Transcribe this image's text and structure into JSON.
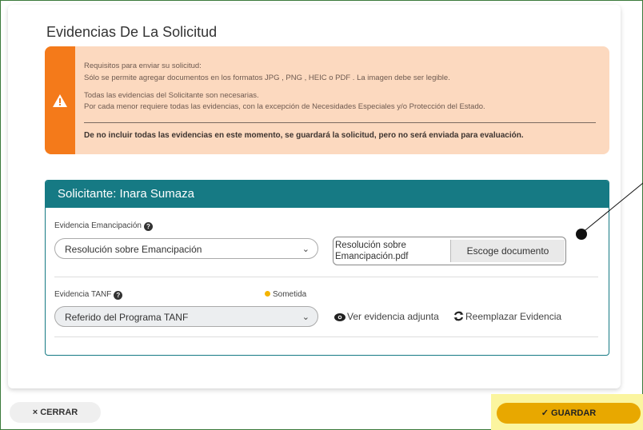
{
  "page": {
    "title": "Evidencias De La Solicitud"
  },
  "alert": {
    "line1": "Requisitos para enviar su solicitud:",
    "line2": "Sólo se permite agregar documentos en los formatos JPG , PNG , HEIC o PDF . La imagen debe ser legible.",
    "line3": "Todas las evidencias del Solicitante son necesarias.",
    "line4": "Por cada menor requiere todas las evidencias, con la excepción de Necesidades Especiales y/o Protección del Estado.",
    "bold": "De no incluir todas las evidencias en este momento, se guardará la solicitud, pero no será enviada para evaluación.",
    "accent_color": "#f47a1a",
    "background_color": "#fcd9bf",
    "icon": "warning-icon"
  },
  "panel": {
    "heading": "Solicitante: Inara Sumaza",
    "header_color": "#167a84",
    "evidence1": {
      "label": "Evidencia Emancipación",
      "help_icon": "?",
      "selected": "Resolución sobre Emancipación",
      "file_name": "Resolución sobre Emancipación.pdf",
      "choose_button": "Escoge documento"
    },
    "evidence2": {
      "label": "Evidencia TANF",
      "help_icon": "?",
      "status": "Sometida",
      "status_color": "#f4b400",
      "selected": "Referido del Programa TANF",
      "view_link": "Ver evidencia adjunta",
      "replace_link": "Reemplazar Evidencia"
    }
  },
  "footer": {
    "close_label": "× CERRAR",
    "save_label": "✓ GUARDAR",
    "save_color": "#e8a800",
    "highlight_color": "#fbf59f"
  }
}
